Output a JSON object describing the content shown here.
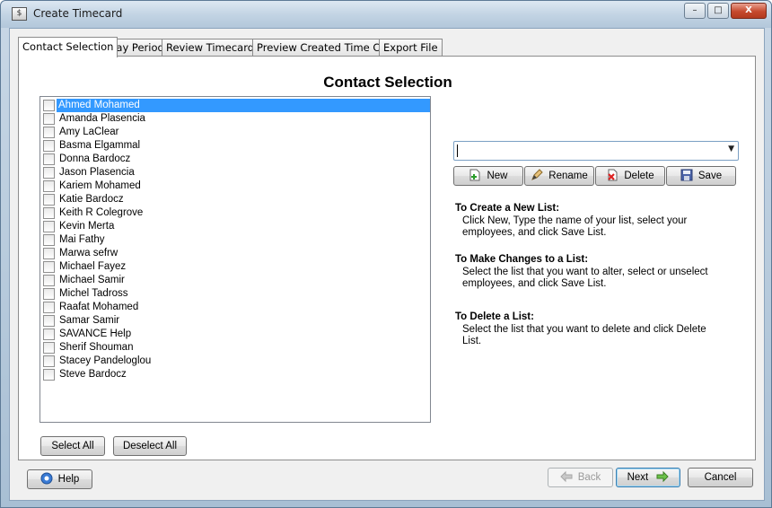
{
  "window": {
    "title": "Create Timecard",
    "controls": {
      "minimize": "–",
      "maximize": "□",
      "close": "X"
    }
  },
  "tabs": [
    {
      "label": "Contact Selection",
      "active": true
    },
    {
      "label": "Pay Period",
      "active": false
    },
    {
      "label": "Review Timecards",
      "active": false
    },
    {
      "label": "Preview Created Time Card",
      "active": false
    },
    {
      "label": "Export File",
      "active": false
    }
  ],
  "contact_selection": {
    "heading": "Contact Selection",
    "contacts": [
      {
        "name": "Ahmed Mohamed",
        "checked": false,
        "selected": true
      },
      {
        "name": "Amanda Plasencia",
        "checked": false,
        "selected": false
      },
      {
        "name": "Amy LaClear",
        "checked": false,
        "selected": false
      },
      {
        "name": "Basma Elgammal",
        "checked": false,
        "selected": false
      },
      {
        "name": "Donna Bardocz",
        "checked": false,
        "selected": false
      },
      {
        "name": "Jason Plasencia",
        "checked": false,
        "selected": false
      },
      {
        "name": "Kariem Mohamed",
        "checked": false,
        "selected": false
      },
      {
        "name": "Katie Bardocz",
        "checked": false,
        "selected": false
      },
      {
        "name": "Keith R Colegrove",
        "checked": false,
        "selected": false
      },
      {
        "name": "Kevin Merta",
        "checked": false,
        "selected": false
      },
      {
        "name": "Mai Fathy",
        "checked": false,
        "selected": false
      },
      {
        "name": "Marwa sefrw",
        "checked": false,
        "selected": false
      },
      {
        "name": "Michael Fayez",
        "checked": false,
        "selected": false
      },
      {
        "name": "Michael Samir",
        "checked": false,
        "selected": false
      },
      {
        "name": "Michel Tadross",
        "checked": false,
        "selected": false
      },
      {
        "name": "Raafat Mohamed",
        "checked": false,
        "selected": false
      },
      {
        "name": "Samar Samir",
        "checked": false,
        "selected": false
      },
      {
        "name": "SAVANCE Help",
        "checked": false,
        "selected": false
      },
      {
        "name": "Sherif Shouman",
        "checked": false,
        "selected": false
      },
      {
        "name": "Stacey Pandeloglou",
        "checked": false,
        "selected": false
      },
      {
        "name": "Steve Bardocz",
        "checked": false,
        "selected": false
      }
    ],
    "list_combo": {
      "value": "",
      "arrow": "▼"
    },
    "list_buttons": {
      "new": "New",
      "rename": "Rename",
      "delete": "Delete",
      "save": "Save"
    },
    "instructions": [
      {
        "heading": "To Create a New List:",
        "body": "Click New, Type the name of your list, select your employees, and click Save List."
      },
      {
        "heading": "To Make Changes to a List:",
        "body": "Select the list that you want to alter, select or unselect employees, and click Save List."
      },
      {
        "heading": "To Delete a List:",
        "body": "Select the list that you want to delete and click Delete List."
      }
    ],
    "select_all": "Select All",
    "deselect_all": "Deselect All"
  },
  "footer": {
    "help": "Help",
    "back": "Back",
    "next": "Next",
    "cancel": "Cancel"
  },
  "colors": {
    "selection": "#3399ff",
    "title_bar": "#c3d4e4",
    "panel": "#f0f0f0"
  }
}
